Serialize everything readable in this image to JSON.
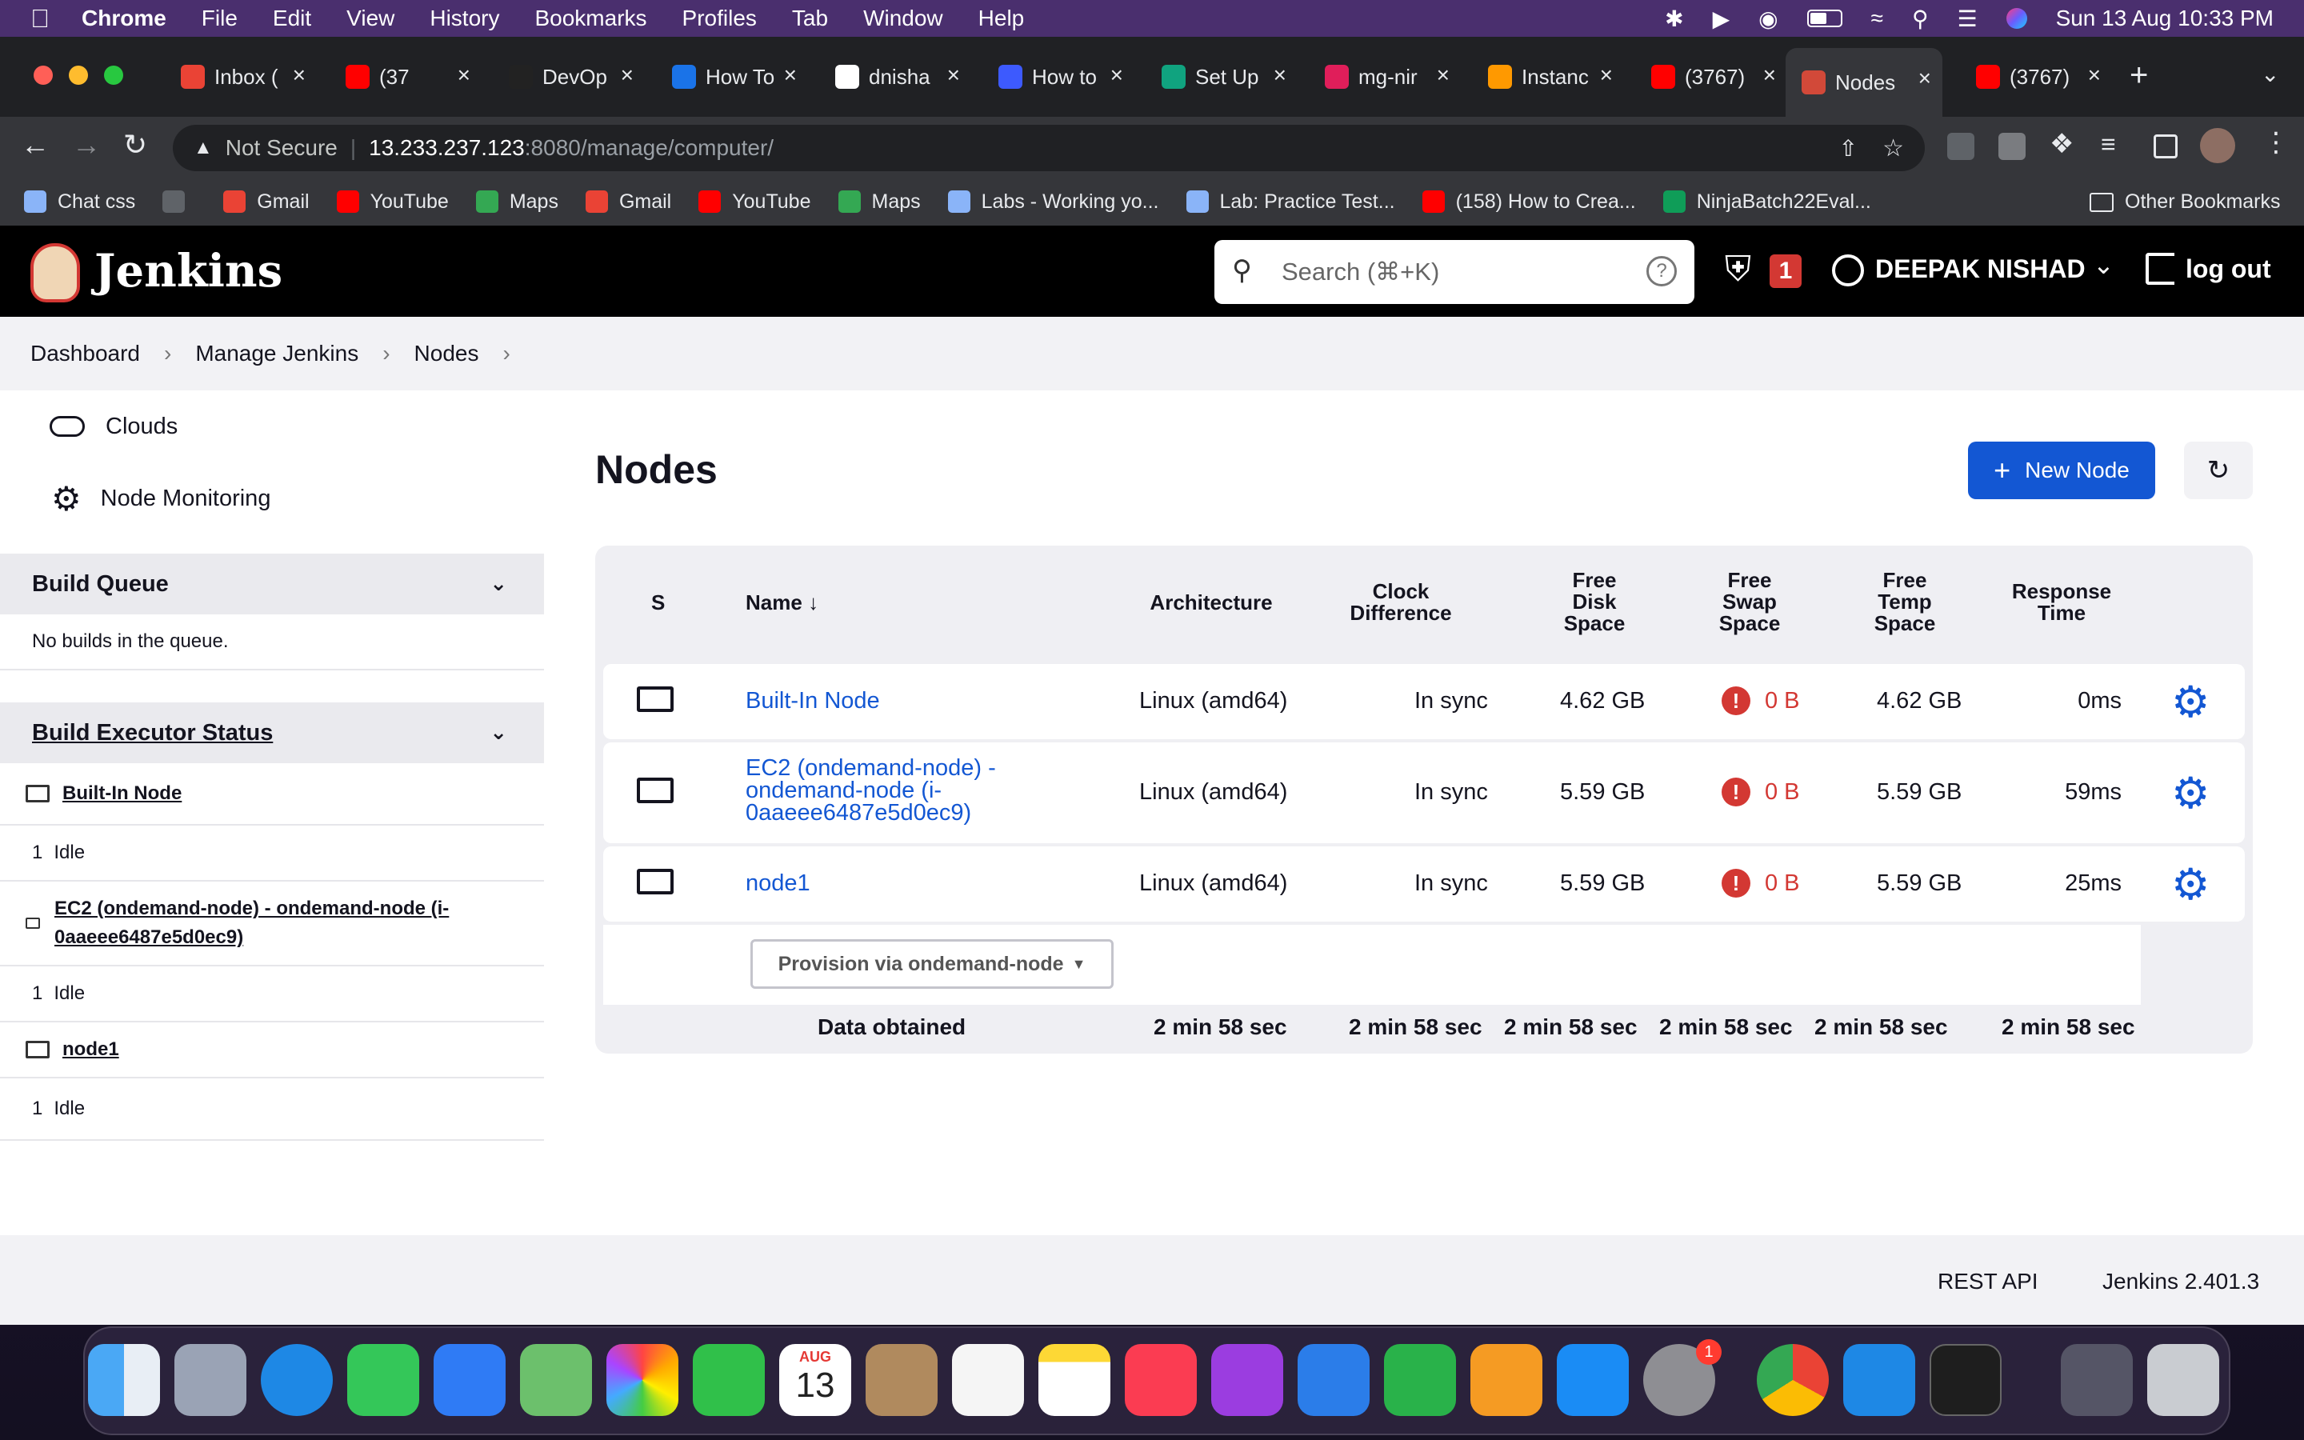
{
  "menubar": {
    "app": "Chrome",
    "items": [
      "File",
      "Edit",
      "View",
      "History",
      "Bookmarks",
      "Profiles",
      "Tab",
      "Window",
      "Help"
    ],
    "clock": "Sun 13 Aug  10:33 PM"
  },
  "tabs": [
    {
      "label": "Inbox (",
      "color": "#ea4335"
    },
    {
      "label": "(37",
      "color": "#ff0000"
    },
    {
      "label": "DevOp",
      "color": "#222222"
    },
    {
      "label": "How To",
      "color": "#1a73e8"
    },
    {
      "label": "dnisha",
      "color": "#ffffff"
    },
    {
      "label": "How to",
      "color": "#3d5afe"
    },
    {
      "label": "Set Up",
      "color": "#10a37f"
    },
    {
      "label": "mg-nir",
      "color": "#e01e5a"
    },
    {
      "label": "Instanc",
      "color": "#ff9900"
    },
    {
      "label": "(3767)",
      "color": "#ff0000"
    },
    {
      "label": "Nodes",
      "color": "#d24939"
    },
    {
      "label": "(3767)",
      "color": "#ff0000"
    }
  ],
  "omnibox": {
    "security": "Not Secure",
    "host": "13.233.237.123",
    "path": ":8080/manage/computer/"
  },
  "bookmarks": [
    {
      "label": "Chat css",
      "color": "#8ab4f8"
    },
    {
      "label": "",
      "color": "#5f6368"
    },
    {
      "label": "Gmail",
      "color": "#ea4335"
    },
    {
      "label": "YouTube",
      "color": "#ff0000"
    },
    {
      "label": "Maps",
      "color": "#34a853"
    },
    {
      "label": "Gmail",
      "color": "#ea4335"
    },
    {
      "label": "YouTube",
      "color": "#ff0000"
    },
    {
      "label": "Maps",
      "color": "#34a853"
    },
    {
      "label": "Labs - Working yo...",
      "color": "#8ab4f8"
    },
    {
      "label": "Lab: Practice Test...",
      "color": "#8ab4f8"
    },
    {
      "label": "(158) How to Crea...",
      "color": "#ff0000"
    },
    {
      "label": "NinjaBatch22Eval...",
      "color": "#0f9d58"
    }
  ],
  "other_bookmarks": "Other Bookmarks",
  "jenkins": {
    "logo_text": "Jenkins",
    "search_placeholder": "Search (⌘+K)",
    "alert_count": "1",
    "user": "DEEPAK NISHAD",
    "logout": "log out"
  },
  "breadcrumb": [
    "Dashboard",
    "Manage Jenkins",
    "Nodes"
  ],
  "sidebar": {
    "links": [
      "Clouds",
      "Node Monitoring"
    ],
    "build_queue_title": "Build Queue",
    "build_queue_empty": "No builds in the queue.",
    "executor_title": "Build Executor Status",
    "executors": [
      {
        "name": "Built-In Node",
        "status_num": "1",
        "status": "Idle"
      },
      {
        "name": "EC2 (ondemand-node) - ondemand-node (i-0aaeee6487e5d0ec9)",
        "status_num": "1",
        "status": "Idle"
      },
      {
        "name": "node1",
        "status_num": "1",
        "status": "Idle"
      }
    ]
  },
  "main": {
    "title": "Nodes",
    "new_node": "New Node"
  },
  "table": {
    "headers": {
      "s": "S",
      "name": "Name",
      "arch": "Architecture",
      "clock": "Clock Difference",
      "disk": "Free Disk Space",
      "swap": "Free Swap Space",
      "temp": "Free Temp Space",
      "resp": "Response Time"
    },
    "rows": [
      {
        "name": "Built-In Node",
        "arch": "Linux (amd64)",
        "clock": "In sync",
        "disk": "4.62 GB",
        "swap": "0 B",
        "temp": "4.62 GB",
        "resp": "0ms"
      },
      {
        "name": "EC2 (ondemand-node) - ondemand-node (i-0aaeee6487e5d0ec9)",
        "arch": "Linux (amd64)",
        "clock": "In sync",
        "disk": "5.59 GB",
        "swap": "0 B",
        "temp": "5.59 GB",
        "resp": "59ms"
      },
      {
        "name": "node1",
        "arch": "Linux (amd64)",
        "clock": "In sync",
        "disk": "5.59 GB",
        "swap": "0 B",
        "temp": "5.59 GB",
        "resp": "25ms"
      }
    ],
    "provision": "Provision via ondemand-node",
    "footer_label": "Data obtained",
    "footer_values": [
      "2 min 58 sec",
      "2 min 58 sec",
      "2 min 58 sec",
      "2 min 58 sec",
      "2 min 58 sec",
      "2 min 58 sec"
    ]
  },
  "footer": {
    "rest_api": "REST API",
    "version": "Jenkins 2.401.3"
  },
  "dock": {
    "calendar_month": "AUG",
    "calendar_day": "13",
    "settings_badge": "1"
  }
}
